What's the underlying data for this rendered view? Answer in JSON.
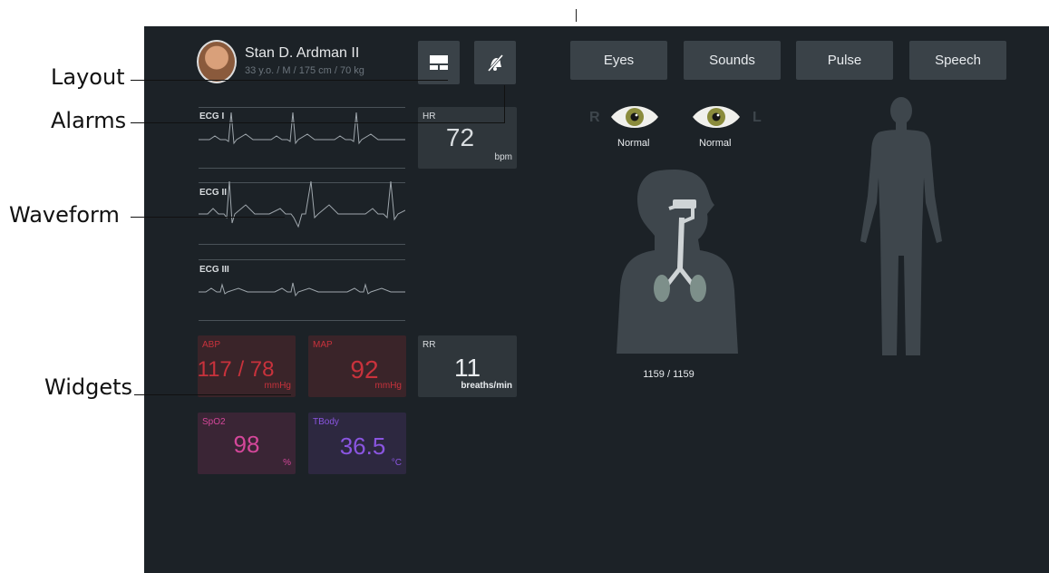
{
  "callouts": {
    "layout": "Layout",
    "alarms": "Alarms",
    "waveform": "Waveform",
    "widgets": "Widgets"
  },
  "patient": {
    "name": "Stan D. Ardman II",
    "details": "33 y.o. / M / 175 cm / 70 kg"
  },
  "toolbar": {
    "layout_icon": "layout-icon",
    "alarms_icon": "alarm-muted-icon"
  },
  "tabs": [
    "Eyes",
    "Sounds",
    "Pulse",
    "Speech"
  ],
  "waveforms": [
    {
      "label": "ECG I"
    },
    {
      "label": "ECG II"
    },
    {
      "label": "ECG III"
    }
  ],
  "vitals": {
    "hr": {
      "label": "HR",
      "value": "72",
      "unit": "bpm"
    },
    "abp": {
      "label": "ABP",
      "value": "117 / 78",
      "unit": "mmHg"
    },
    "map": {
      "label": "MAP",
      "value": "92",
      "unit": "mmHg"
    },
    "rr": {
      "label": "RR",
      "value": "11",
      "unit": "breaths/min"
    },
    "spo2": {
      "label": "SpO2",
      "value": "98",
      "unit": "%"
    },
    "tbody": {
      "label": "TBody",
      "value": "36.5",
      "unit": "°C"
    }
  },
  "eyes": {
    "right_letter": "R",
    "left_letter": "L",
    "right_status": "Normal",
    "left_status": "Normal"
  },
  "airway": {
    "count": "1159 / 1159"
  },
  "colors": {
    "panel_bg": "#1c2227",
    "button_bg": "#3a4248",
    "abp": "#c8323c",
    "spo2": "#d4479a",
    "tbody": "#8a55e0",
    "ecg": "#9fa7ad"
  }
}
